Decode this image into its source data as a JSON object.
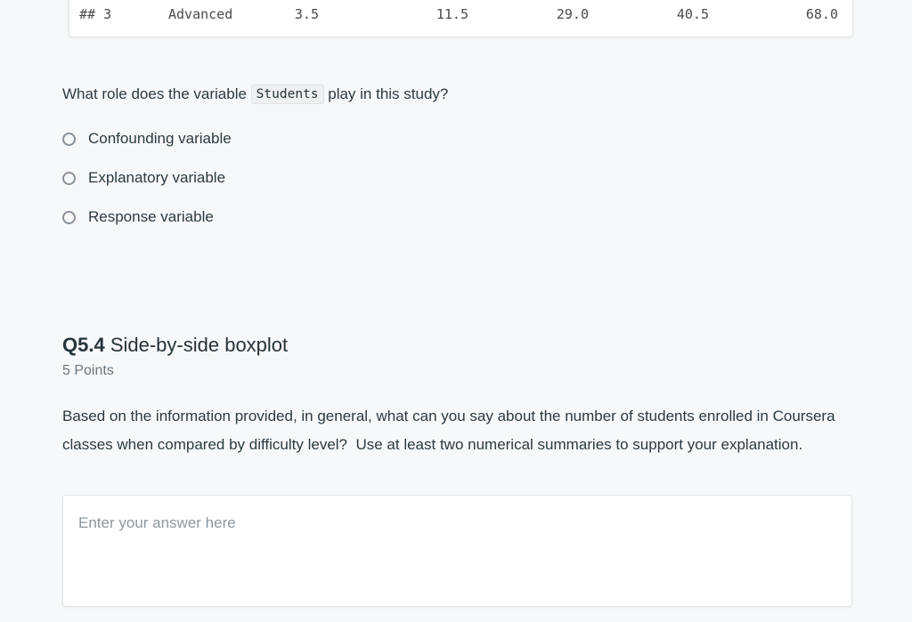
{
  "page": {
    "background_color": "#f7f8fa"
  },
  "code_output": {
    "prefix": "## 3",
    "group_label": "Advanced",
    "values": [
      "3.5",
      "11.5",
      "29.0",
      "40.5",
      "68.0"
    ]
  },
  "multiple_choice": {
    "question_prefix": "What role does the variable ",
    "question_code": "Students",
    "question_suffix": " play in this study?",
    "options": [
      {
        "label": "Confounding variable",
        "selected": false
      },
      {
        "label": "Explanatory variable",
        "selected": false
      },
      {
        "label": "Response variable",
        "selected": false
      }
    ]
  },
  "question_section": {
    "number": "Q5.4",
    "title": " Side-by-side boxplot",
    "points": "5 Points",
    "body": "Based on the information provided, in general, what can you say about the number of students enrolled in Coursera classes when compared by difficulty level?  Use at least two numerical summaries to support your explanation.",
    "answer_placeholder": "Enter your answer here",
    "answer_value": ""
  }
}
